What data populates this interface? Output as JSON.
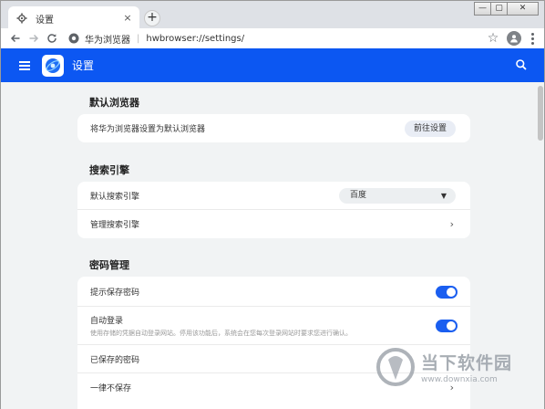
{
  "tab": {
    "title": "设置",
    "close": "×",
    "new_tab": "+"
  },
  "window": {
    "minimize": "—",
    "maximize": "▢",
    "close": "✕"
  },
  "address": {
    "site_name": "华为浏览器",
    "separator": "|",
    "url": "hwbrowser://settings/"
  },
  "header": {
    "title": "设置"
  },
  "sections": {
    "default_browser": {
      "title": "默认浏览器",
      "row_label": "将华为浏览器设置为默认浏览器",
      "button": "前往设置"
    },
    "search_engine": {
      "title": "搜索引擎",
      "default_label": "默认搜索引擎",
      "selected": "百度",
      "manage_label": "管理搜索引擎"
    },
    "passwords": {
      "title": "密码管理",
      "offer_save": {
        "label": "提示保存密码",
        "enabled": true
      },
      "auto_signin": {
        "label": "自动登录",
        "description": "使用存储的凭据自动登录网站。停用该功能后，系统会在您每次登录网站时要求您进行确认。",
        "enabled": true
      },
      "saved_passwords": "已保存的密码",
      "never_saved": "一律不保存"
    }
  },
  "watermark": {
    "name": "当下软件园",
    "url": "www.downxia.com"
  },
  "colors": {
    "accent": "#0c57f2",
    "toggle_on": "#1a5ef0",
    "page_bg": "#f1f3f4"
  }
}
